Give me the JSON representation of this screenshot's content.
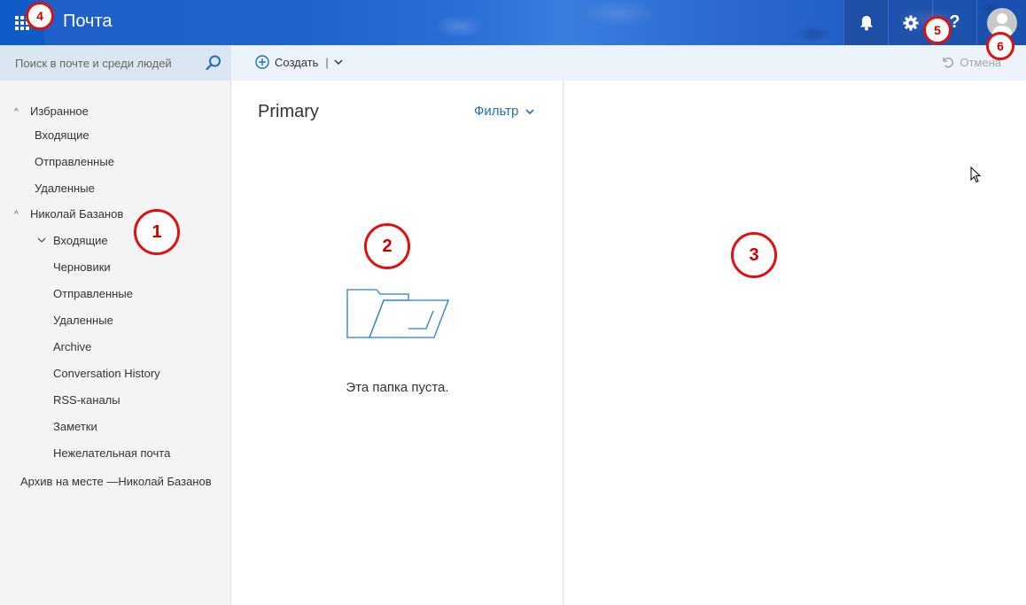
{
  "header": {
    "app_title": "Почта",
    "icons": [
      "app-launcher-icon",
      "bell-icon",
      "gear-icon",
      "help-icon",
      "avatar-icon"
    ],
    "help_glyph": "?"
  },
  "search": {
    "placeholder": "Поиск в почте и среди людей"
  },
  "commandbar": {
    "new_label": "Создать",
    "separator": "|",
    "undo_label": "Отмена"
  },
  "folders": {
    "favorites_label": "Избранное",
    "favorites": [
      "Входящие",
      "Отправленные",
      "Удаленные"
    ],
    "account_label": "Николай Базанов",
    "inbox_label": "Входящие",
    "account_folders": [
      "Черновики",
      "Отправленные",
      "Удаленные",
      "Archive",
      "Conversation History",
      "RSS-каналы",
      "Заметки",
      "Нежелательная почта"
    ],
    "archive_label": "Архив на месте —Николай Базанов"
  },
  "list": {
    "title": "Primary",
    "filter_label": "Фильтр",
    "empty_text": "Эта папка пуста."
  },
  "markers": [
    "1",
    "2",
    "3",
    "4",
    "5",
    "6"
  ],
  "colors": {
    "header": "#1f63cc",
    "accent": "#1e6fbf",
    "marker": "#e01010"
  }
}
